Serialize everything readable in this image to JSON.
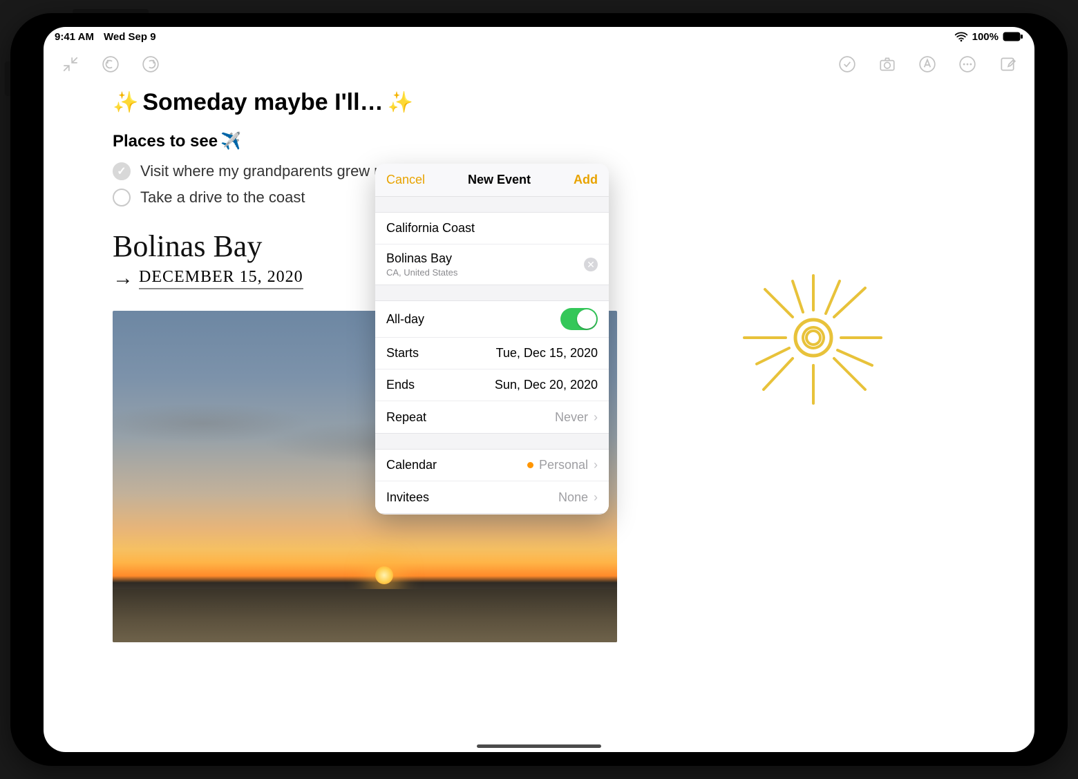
{
  "status": {
    "time": "9:41 AM",
    "date": "Wed Sep 9",
    "battery": "100%"
  },
  "toolbar": {
    "icons": [
      "collapse",
      "undo",
      "redo",
      "checklist",
      "camera",
      "markup",
      "more",
      "compose"
    ]
  },
  "note": {
    "title": "Someday maybe I'll…",
    "section_title": "Places to see",
    "checklist": [
      {
        "text": "Visit where my grandparents grew up",
        "done": true
      },
      {
        "text": "Take a drive to the coast",
        "done": false
      }
    ],
    "handwriting": "Bolinas Bay",
    "date_hand": "DECEMBER 15, 2020"
  },
  "popover": {
    "cancel": "Cancel",
    "title": "New Event",
    "add": "Add",
    "event_title": "California Coast",
    "location": "Bolinas Bay",
    "location_sub": "CA, United States",
    "allday_label": "All-day",
    "allday_on": true,
    "starts_label": "Starts",
    "starts_value": "Tue, Dec 15, 2020",
    "ends_label": "Ends",
    "ends_value": "Sun, Dec 20, 2020",
    "repeat_label": "Repeat",
    "repeat_value": "Never",
    "calendar_label": "Calendar",
    "calendar_value": "Personal",
    "invitees_label": "Invitees",
    "invitees_value": "None"
  }
}
